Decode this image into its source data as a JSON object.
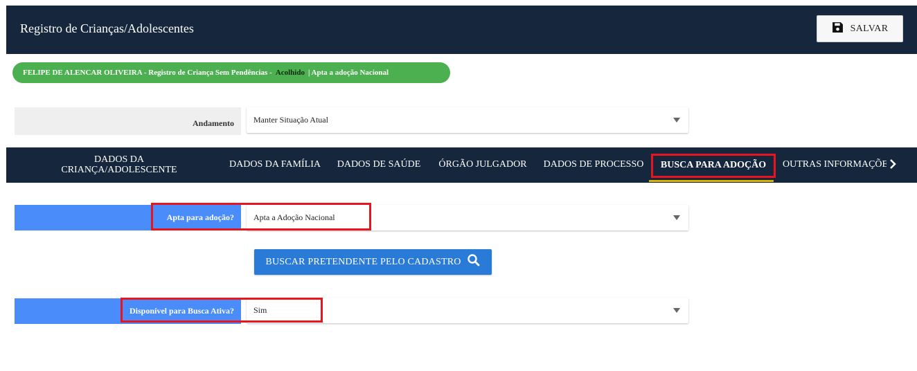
{
  "header": {
    "title": "Registro de Crianças/Adolescentes",
    "save_label": "SALVAR"
  },
  "status": {
    "prefix": "FELIPE DE ALENCAR OLIVEIRA - Registro de Criança Sem Pendências -",
    "state": "Acolhido",
    "suffix": "| Apta a adoção Nacional"
  },
  "andamento": {
    "label": "Andamento",
    "value": "Manter Situação Atual"
  },
  "tabs": [
    {
      "label_line1": "DADOS DA",
      "label_line2": "CRIANÇA/ADOLESCENTE"
    },
    {
      "label": "DADOS DA FAMÍLIA"
    },
    {
      "label": "DADOS DE SAÚDE"
    },
    {
      "label": "ÓRGÃO JULGADOR"
    },
    {
      "label": "DADOS DE PROCESSO"
    },
    {
      "label": "BUSCA PARA ADOÇÃO",
      "active": true
    },
    {
      "label": "OUTRAS INFORMAÇÕE"
    }
  ],
  "form": {
    "apta_label": "Apta para adoção?",
    "apta_value": "Apta a Adoção Nacional",
    "buscar_label": "BUSCAR PRETENDENTE PELO CADASTRO",
    "busca_ativa_label": "Disponível para Busca Ativa?",
    "busca_ativa_value": "Sim"
  },
  "icons": {
    "save": "floppy-disk-icon",
    "search": "search-icon",
    "next": "chevron-right-icon"
  },
  "colors": {
    "header_bg": "#15263d",
    "status_green": "#4caf50",
    "label_blue": "#4a8dfa",
    "button_blue": "#2a7bd8",
    "highlight_red": "#e8141e",
    "active_tab_underline": "#d8b400"
  }
}
